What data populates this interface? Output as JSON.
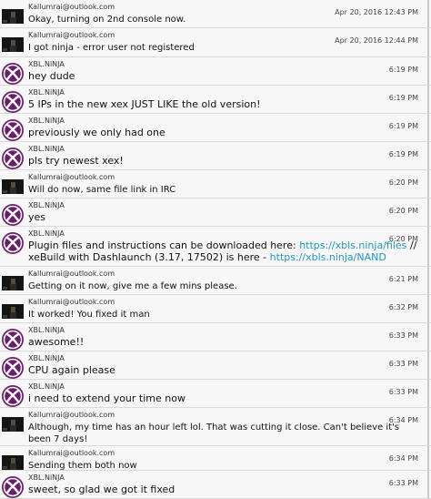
{
  "messages": [
    {
      "kind": "kal",
      "sender": "Kallumrai@outlook.com",
      "time": "Apr 20, 2016 12:43 PM",
      "text": "Okay, turning on 2nd console now."
    },
    {
      "kind": "kal",
      "sender": "Kallumrai@outlook.com",
      "time": "Apr 20, 2016 12:44 PM",
      "text": "I got ninja - error user not registered"
    },
    {
      "kind": "xbl",
      "sender": "XBL.NiNJA",
      "time": "6:19 PM",
      "text": "hey dude"
    },
    {
      "kind": "xbl",
      "sender": "XBL.NiNJA",
      "time": "6:19 PM",
      "text": "5 IPs in the new xex JUST LIKE the old version!"
    },
    {
      "kind": "xbl",
      "sender": "XBL.NiNJA",
      "time": "6:19 PM",
      "text": "previously we only had one"
    },
    {
      "kind": "xbl",
      "sender": "XBL.NiNJA",
      "time": "6:19 PM",
      "text": "pls try newest xex!"
    },
    {
      "kind": "kal",
      "sender": "Kallumrai@outlook.com",
      "time": "6:20 PM",
      "text": "Will do now, same file link in IRC"
    },
    {
      "kind": "xbl",
      "sender": "XBL.NiNJA",
      "time": "6:20 PM",
      "text": "yes"
    },
    {
      "kind": "xbl",
      "sender": "XBL.NiNJA",
      "time": "6:20 PM",
      "text": "",
      "line1_pre": "Plugin files and instructions can be downloaded here: ",
      "line1_link": "https://xbls.ninja/files",
      "line1_post": " //",
      "line2_pre": "xeBuild with Dashlaunch (3.17, 17502) is here - ",
      "line2_link": "https://xbls.ninja/NAND"
    },
    {
      "kind": "kal",
      "sender": "Kallumrai@outlook.com",
      "time": "6:21 PM",
      "text": "Getting on it now, give me a few mins please."
    },
    {
      "kind": "kal",
      "sender": "Kallumrai@outlook.com",
      "time": "6:32 PM",
      "text": "It worked! You fixed it man"
    },
    {
      "kind": "xbl",
      "sender": "XBL.NiNJA",
      "time": "6:33 PM",
      "text": "awesome!!"
    },
    {
      "kind": "xbl",
      "sender": "XBL.NiNJA",
      "time": "6:33 PM",
      "text": "CPU again please"
    },
    {
      "kind": "xbl",
      "sender": "XBL.NiNJA",
      "time": "6:33 PM",
      "text": "i need to extend your time now"
    },
    {
      "kind": "kal",
      "sender": "Kallumrai@outlook.com",
      "time": "6:34 PM",
      "text": "Although, my time has an hour left lol. That was cutting it close. Can't believe it's been 7 days!"
    },
    {
      "kind": "kal",
      "sender": "Kallumrai@outlook.com",
      "time": "6:34 PM",
      "text": "Sending them both now"
    },
    {
      "kind": "xbl",
      "sender": "XBL.NiNJA",
      "time": "6:33 PM",
      "text": "sweet, so glad we got it fixed"
    }
  ],
  "colors": {
    "xbl_avatar": "#6b1f6b",
    "link": "#2196c4"
  },
  "icons": {
    "kal": "kallum-avatar-icon",
    "xbl": "xbox-logo-icon"
  }
}
